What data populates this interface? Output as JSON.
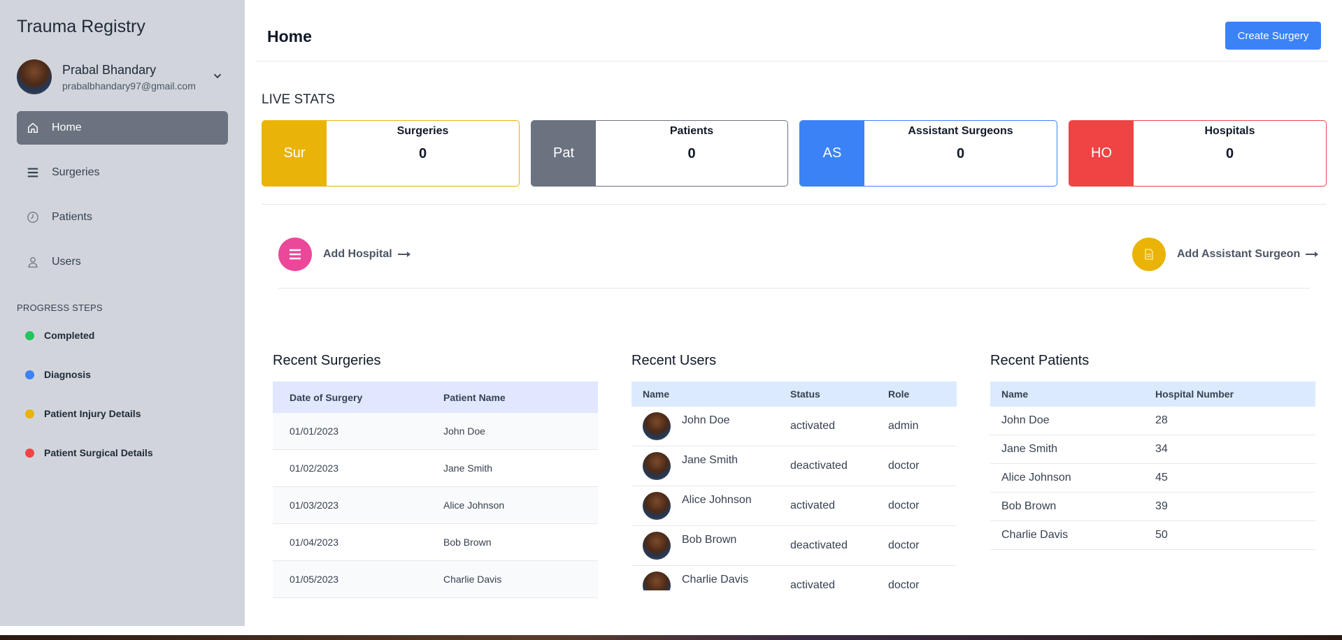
{
  "app": {
    "title": "Trauma Registry"
  },
  "profile": {
    "name": "Prabal Bhandary",
    "email": "prabalbhandary97@gmail.com"
  },
  "nav": {
    "home": "Home",
    "surgeries": "Surgeries",
    "patients": "Patients",
    "users": "Users"
  },
  "progress": {
    "title": "PROGRESS STEPS",
    "steps": [
      {
        "label": "Completed",
        "color": "#22c55e"
      },
      {
        "label": "Diagnosis",
        "color": "#3b82f6"
      },
      {
        "label": "Patient Injury Details",
        "color": "#eab308"
      },
      {
        "label": "Patient Surgical Details",
        "color": "#ef4444"
      }
    ]
  },
  "header": {
    "title": "Home",
    "create_label": "Create Surgery"
  },
  "live_stats": {
    "title": "LIVE STATS",
    "cards": [
      {
        "abbr": "Sur",
        "label": "Surgeries",
        "value": "0",
        "color": "#eab308"
      },
      {
        "abbr": "Pat",
        "label": "Patients",
        "value": "0",
        "color": "#6b7280"
      },
      {
        "abbr": "AS",
        "label": "Assistant Surgeons",
        "value": "0",
        "color": "#3b82f6"
      },
      {
        "abbr": "HO",
        "label": "Hospitals",
        "value": "0",
        "color": "#ef4444"
      }
    ]
  },
  "actions": {
    "add_hospital": "Add Hospital",
    "add_assistant": "Add Assistant Surgeon"
  },
  "recent_surgeries": {
    "title": "Recent Surgeries",
    "headers": [
      "Date of Surgery",
      "Patient Name"
    ],
    "rows": [
      [
        "01/01/2023",
        "John Doe"
      ],
      [
        "01/02/2023",
        "Jane Smith"
      ],
      [
        "01/03/2023",
        "Alice Johnson"
      ],
      [
        "01/04/2023",
        "Bob Brown"
      ],
      [
        "01/05/2023",
        "Charlie Davis"
      ]
    ]
  },
  "recent_users": {
    "title": "Recent Users",
    "headers": [
      "Name",
      "Status",
      "Role"
    ],
    "rows": [
      [
        "John Doe",
        "activated",
        "admin"
      ],
      [
        "Jane Smith",
        "deactivated",
        "doctor"
      ],
      [
        "Alice Johnson",
        "activated",
        "doctor"
      ],
      [
        "Bob Brown",
        "deactivated",
        "doctor"
      ],
      [
        "Charlie Davis",
        "activated",
        "doctor"
      ]
    ]
  },
  "recent_patients": {
    "title": "Recent Patients",
    "headers": [
      "Name",
      "Hospital Number"
    ],
    "rows": [
      [
        "John Doe",
        "28"
      ],
      [
        "Jane Smith",
        "34"
      ],
      [
        "Alice Johnson",
        "45"
      ],
      [
        "Bob Brown",
        "39"
      ],
      [
        "Charlie Davis",
        "50"
      ]
    ]
  }
}
